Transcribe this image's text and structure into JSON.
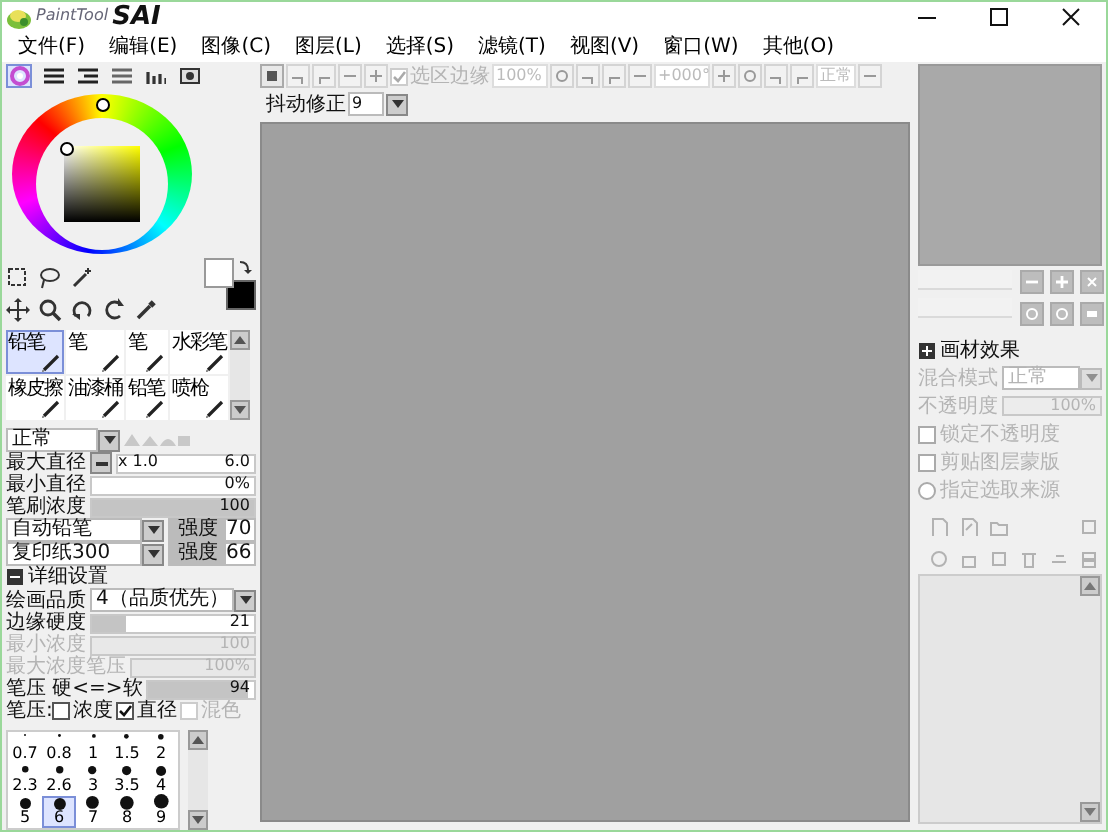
{
  "window": {
    "logo_small": "PaintTool",
    "logo_big": "SAI"
  },
  "menu": [
    {
      "label": "文件(F)"
    },
    {
      "label": "编辑(E)"
    },
    {
      "label": "图像(C)"
    },
    {
      "label": "图层(L)"
    },
    {
      "label": "选择(S)"
    },
    {
      "label": "滤镜(T)"
    },
    {
      "label": "视图(V)"
    },
    {
      "label": "窗口(W)"
    },
    {
      "label": "其他(O)"
    }
  ],
  "color_tabs": [
    {
      "selected": true
    },
    {
      "selected": false
    },
    {
      "selected": false
    },
    {
      "selected": false
    },
    {
      "selected": false
    },
    {
      "selected": false
    }
  ],
  "tools": [
    {
      "label": "铅笔",
      "selected": true
    },
    {
      "label": "笔",
      "selected": false
    },
    {
      "label": "笔",
      "selected": false
    },
    {
      "label": "水彩笔",
      "selected": false
    },
    {
      "label": "橡皮擦",
      "selected": false
    },
    {
      "label": "油漆桶",
      "selected": false
    },
    {
      "label": "铅笔",
      "selected": false
    },
    {
      "label": "喷枪",
      "selected": false
    }
  ],
  "blend_mode": "正常",
  "brush_settings": [
    {
      "kind": "spin",
      "label": "最大直径",
      "multiplier": "x 1.0",
      "value": "6.0"
    },
    {
      "kind": "slider",
      "label": "最小直径",
      "value": "0%",
      "level": 0,
      "disabled": false
    },
    {
      "kind": "slider",
      "label": "笔刷浓度",
      "value": "100",
      "level": 1,
      "disabled": false
    },
    {
      "kind": "texture",
      "value": "自动铅笔",
      "strength_label": "强度",
      "strength": "70"
    },
    {
      "kind": "texture",
      "value": "复印纸300",
      "strength_label": "强度",
      "strength": "66"
    },
    {
      "kind": "section",
      "label": "详细设置",
      "expanded": true
    },
    {
      "kind": "select",
      "label": "绘画品质",
      "value": "4（品质优先）"
    },
    {
      "kind": "slider",
      "label": "边缘硬度",
      "value": "21",
      "level": 0.21,
      "disabled": false
    },
    {
      "kind": "slider",
      "label": "最小浓度",
      "value": "100",
      "level": 1,
      "disabled": true
    },
    {
      "kind": "slider",
      "label": "最大浓度笔压",
      "value": "100%",
      "level": 1,
      "disabled": true
    },
    {
      "kind": "slider",
      "label": "笔压 硬<=>软",
      "value": "94",
      "level": 0.94,
      "disabled": false
    },
    {
      "kind": "checks",
      "label": "笔压:",
      "options": [
        {
          "label": "浓度",
          "checked": false,
          "disabled": false
        },
        {
          "label": "直径",
          "checked": true,
          "disabled": false
        },
        {
          "label": "混色",
          "checked": false,
          "disabled": true
        }
      ]
    }
  ],
  "brush_sizes": [
    {
      "label": "0.7",
      "selected": false
    },
    {
      "label": "0.8",
      "selected": false
    },
    {
      "label": "1",
      "selected": false
    },
    {
      "label": "1.5",
      "selected": false
    },
    {
      "label": "2",
      "selected": false
    },
    {
      "label": "2.3",
      "selected": false
    },
    {
      "label": "2.6",
      "selected": false
    },
    {
      "label": "3",
      "selected": false
    },
    {
      "label": "3.5",
      "selected": false
    },
    {
      "label": "4",
      "selected": false
    },
    {
      "label": "5",
      "selected": false
    },
    {
      "label": "6",
      "selected": true
    },
    {
      "label": "7",
      "selected": false
    },
    {
      "label": "8",
      "selected": false
    },
    {
      "label": "9",
      "selected": false
    }
  ],
  "toolbar": [
    {
      "kind": "icon",
      "disabled": false
    },
    {
      "kind": "icon",
      "disabled": true
    },
    {
      "kind": "icon",
      "disabled": true
    },
    {
      "kind": "icon",
      "disabled": true
    },
    {
      "kind": "icon",
      "disabled": true
    },
    {
      "kind": "check",
      "label": "选区边缘",
      "checked": true,
      "disabled": true
    },
    {
      "kind": "field",
      "value": "100%",
      "disabled": true
    },
    {
      "kind": "icon",
      "disabled": true
    },
    {
      "kind": "icon",
      "disabled": true
    },
    {
      "kind": "icon",
      "disabled": true
    },
    {
      "kind": "icon",
      "disabled": true
    },
    {
      "kind": "field",
      "value": "+000°",
      "disabled": true
    },
    {
      "kind": "icon",
      "disabled": true
    },
    {
      "kind": "icon",
      "disabled": true
    },
    {
      "kind": "icon",
      "disabled": true
    },
    {
      "kind": "icon",
      "disabled": true
    },
    {
      "kind": "button",
      "label": "正常",
      "disabled": true
    },
    {
      "kind": "icon",
      "disabled": true
    }
  ],
  "stabilizer": {
    "label": "抖动修正",
    "value": "9"
  },
  "navigator_sliders": [
    {
      "disabled": true
    },
    {
      "disabled": true
    }
  ],
  "layer_effects": {
    "label": "画材效果",
    "expanded": false
  },
  "layer_props": [
    {
      "kind": "select",
      "label": "混合模式",
      "value": "正常",
      "disabled": true
    },
    {
      "kind": "slider",
      "label": "不透明度",
      "value": "100%",
      "level": 1,
      "disabled": true
    },
    {
      "kind": "check",
      "label": "锁定不透明度",
      "checked": false,
      "disabled": true
    },
    {
      "kind": "check",
      "label": "剪贴图层蒙版",
      "checked": false,
      "disabled": true
    },
    {
      "kind": "radio",
      "label": "指定选取来源",
      "checked": false,
      "disabled": true
    }
  ],
  "layer_buttons": [
    {
      "disabled": true
    },
    {
      "disabled": true
    },
    {
      "disabled": true
    },
    {
      "disabled": true
    },
    {
      "disabled": true
    },
    {
      "disabled": true
    },
    {
      "disabled": true
    },
    {
      "disabled": true
    },
    {
      "disabled": true
    },
    {
      "disabled": true
    }
  ]
}
